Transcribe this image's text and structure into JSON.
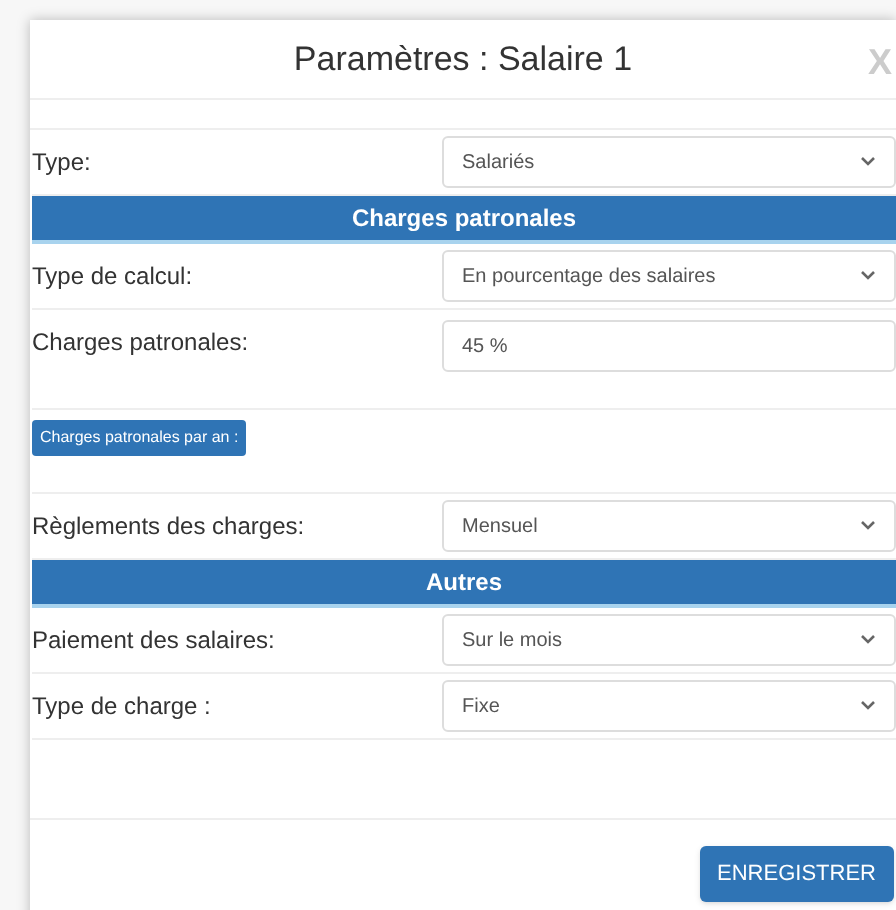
{
  "dialog": {
    "title": "Paramètres : Salaire 1",
    "close": "X"
  },
  "rows": [
    {
      "kind": "select",
      "label": "Type:",
      "value": "Salariés"
    },
    {
      "kind": "section",
      "label": "Charges patronales"
    },
    {
      "kind": "select",
      "label": "Type de calcul:",
      "value": "En pourcentage des salaires"
    },
    {
      "kind": "input",
      "label": "Charges patronales:",
      "value": "45 %"
    },
    {
      "kind": "button",
      "label": "Charges patronales par an :"
    },
    {
      "kind": "select",
      "label": "Règlements des charges:",
      "value": "Mensuel"
    },
    {
      "kind": "section",
      "label": "Autres"
    },
    {
      "kind": "select",
      "label": "Paiement des salaires:",
      "value": "Sur le mois"
    },
    {
      "kind": "select",
      "label": "Type de charge :",
      "value": "Fixe"
    }
  ],
  "save_button": "ENREGISTRER"
}
